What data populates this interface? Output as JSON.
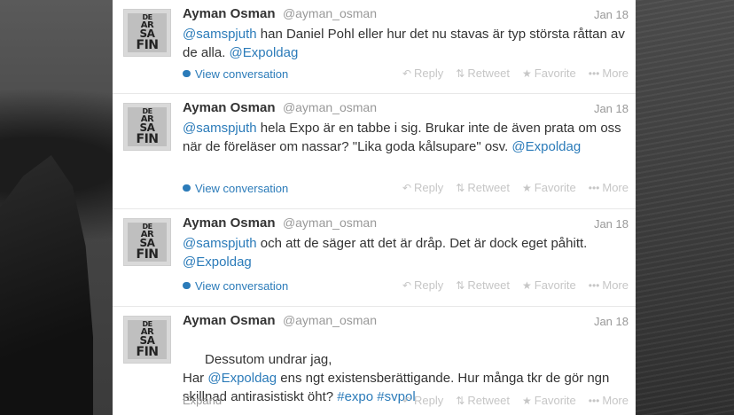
{
  "tweets": [
    {
      "name": "Ayman Osman",
      "handle": "@ayman_osman",
      "date": "Jan 18",
      "text_parts": [
        {
          "t": "@samspjuth",
          "link": true
        },
        {
          "t": " han Daniel Pohl eller hur det nu stavas är typ största råttan av de alla. ",
          "link": false
        },
        {
          "t": "@Expoldag",
          "link": true
        }
      ],
      "footer_link": "View conversation"
    },
    {
      "name": "Ayman Osman",
      "handle": "@ayman_osman",
      "date": "Jan 18",
      "text_parts": [
        {
          "t": "@samspjuth",
          "link": true
        },
        {
          "t": " hela Expo är en tabbe i sig. Brukar inte de även prata om oss när de föreläser om nassar? \"Lika goda kålsupare\" osv. ",
          "link": false
        },
        {
          "t": "@Expoldag",
          "link": true
        }
      ],
      "footer_link": "View conversation"
    },
    {
      "name": "Ayman Osman",
      "handle": "@ayman_osman",
      "date": "Jan 18",
      "text_parts": [
        {
          "t": "@samspjuth",
          "link": true
        },
        {
          "t": " och att de säger att det är dråp. Det är dock eget påhitt.  ",
          "link": false
        },
        {
          "t": "@Expoldag",
          "link": true
        }
      ],
      "footer_link": "View conversation"
    },
    {
      "name": "Ayman Osman",
      "handle": "@ayman_osman",
      "date": "Jan 18",
      "text_parts": [
        {
          "t": "Dessutom undrar jag,\nHar ",
          "link": false
        },
        {
          "t": "@Expoldag",
          "link": true
        },
        {
          "t": " ens ngt existensberättigande. Hur många tkr de gör ngn skillnad antirasistiskt öht? ",
          "link": false
        },
        {
          "t": "#expo",
          "link": true
        },
        {
          "t": " ",
          "link": false
        },
        {
          "t": "#svpol",
          "link": true
        }
      ],
      "footer_link": "Expand"
    }
  ],
  "avatar_text": [
    "DE",
    "AR",
    "SA",
    "FIN"
  ],
  "actions": {
    "reply": "Reply",
    "retweet": "Retweet",
    "favorite": "Favorite",
    "more": "More"
  },
  "colors": {
    "link": "#2b7bb9",
    "muted": "#999999",
    "action": "#c6c6c6"
  },
  "icons": {
    "reply": "reply-icon",
    "retweet": "retweet-icon",
    "favorite": "star-icon",
    "more": "more-dots-icon",
    "conversation": "conversation-bubble-icon"
  }
}
